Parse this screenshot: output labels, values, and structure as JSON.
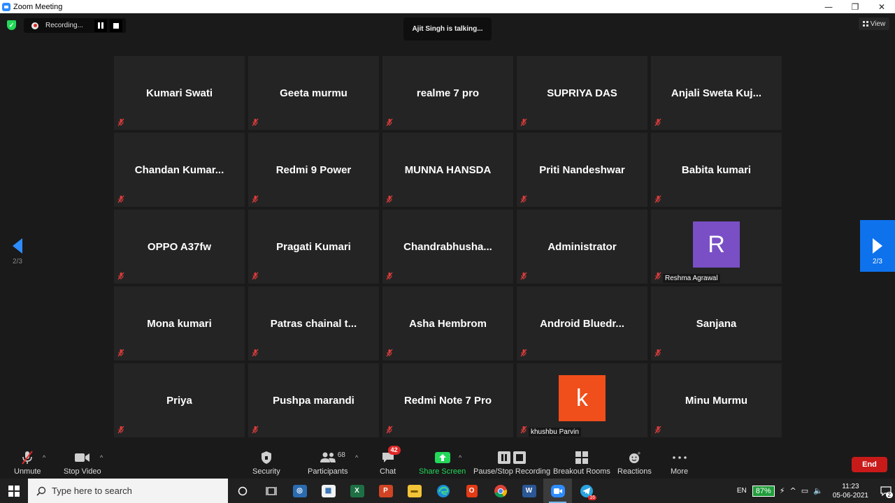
{
  "window": {
    "title": "Zoom Meeting",
    "minimize": "—",
    "maximize": "❐",
    "close": "✕"
  },
  "top": {
    "recording_label": "Recording...",
    "talking_label": "Ajit Singh is talking...",
    "view_label": "View"
  },
  "gallery": {
    "page_label": "2/3",
    "tiles": [
      {
        "name": "Kumari Swati"
      },
      {
        "name": "Geeta murmu"
      },
      {
        "name": "realme 7 pro"
      },
      {
        "name": "SUPRIYA DAS"
      },
      {
        "name": "Anjali  Sweta  Kuj..."
      },
      {
        "name": "Chandan  Kumar..."
      },
      {
        "name": "Redmi 9 Power"
      },
      {
        "name": "MUNNA HANSDA"
      },
      {
        "name": "Priti Nandeshwar"
      },
      {
        "name": "Babita kumari"
      },
      {
        "name": "OPPO A37fw"
      },
      {
        "name": "Pragati Kumari"
      },
      {
        "name": "Chandrabhusha..."
      },
      {
        "name": "Administrator"
      },
      {
        "avatar_letter": "R",
        "avatar_color": "#7a4fc6",
        "label": "Reshma Agrawal"
      },
      {
        "name": "Mona kumari"
      },
      {
        "name": "Patras  chainal  t..."
      },
      {
        "name": "Asha Hembrom"
      },
      {
        "name": "Android  Bluedr..."
      },
      {
        "name": "Sanjana"
      },
      {
        "name": "Priya"
      },
      {
        "name": "Pushpa marandi"
      },
      {
        "name": "Redmi Note 7 Pro"
      },
      {
        "avatar_letter": "k",
        "avatar_color": "#f04e1b",
        "label": "khushbu Parvin"
      },
      {
        "name": "Minu Murmu"
      }
    ]
  },
  "toolbar": {
    "unmute": "Unmute",
    "stop_video": "Stop Video",
    "security": "Security",
    "participants": "Participants",
    "participants_count": "68",
    "chat": "Chat",
    "chat_badge": "42",
    "share_screen": "Share Screen",
    "pause_stop_recording": "Pause/Stop Recording",
    "breakout_rooms": "Breakout Rooms",
    "reactions": "Reactions",
    "more": "More",
    "end": "End",
    "share_color": "#23d959",
    "end_color": "#c91a1a"
  },
  "taskbar": {
    "search_placeholder": "Type here to search",
    "language": "EN",
    "battery": "87%",
    "time": "11:23",
    "date": "05-06-2021",
    "notification_count": "2",
    "telegram_badge": "16"
  }
}
